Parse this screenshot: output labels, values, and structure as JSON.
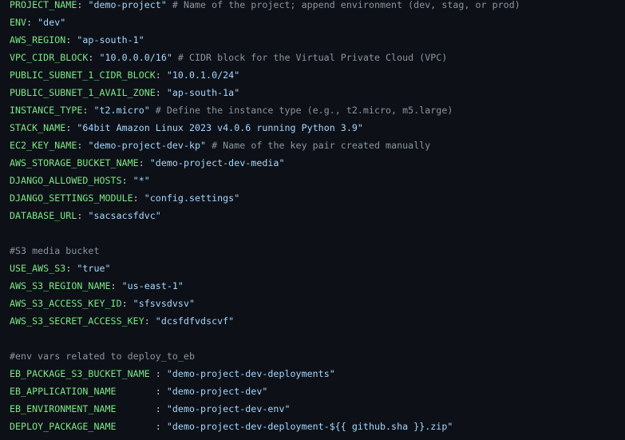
{
  "lines": [
    {
      "key": "PROJECT_NAME",
      "sep": ": ",
      "value": "\"demo-project\"",
      "comment": " # Name of the project; append environment (dev, stag, or prod)"
    },
    {
      "key": "ENV",
      "sep": ": ",
      "value": "\"dev\"",
      "comment": ""
    },
    {
      "key": "AWS_REGION",
      "sep": ": ",
      "value": "\"ap-south-1\"",
      "comment": ""
    },
    {
      "key": "VPC_CIDR_BLOCK",
      "sep": ": ",
      "value": "\"10.0.0.0/16\"",
      "comment": " # CIDR block for the Virtual Private Cloud (VPC)"
    },
    {
      "key": "PUBLIC_SUBNET_1_CIDR_BLOCK",
      "sep": ": ",
      "value": "\"10.0.1.0/24\"",
      "comment": ""
    },
    {
      "key": "PUBLIC_SUBNET_1_AVAIL_ZONE",
      "sep": ": ",
      "value": "\"ap-south-1a\"",
      "comment": ""
    },
    {
      "key": "INSTANCE_TYPE",
      "sep": ": ",
      "value": "\"t2.micro\"",
      "comment": " # Define the instance type (e.g., t2.micro, m5.large)"
    },
    {
      "key": "STACK_NAME",
      "sep": ": ",
      "value": "\"64bit Amazon Linux 2023 v4.0.6 running Python 3.9\"",
      "comment": ""
    },
    {
      "key": "EC2_KEY_NAME",
      "sep": ": ",
      "value": "\"demo-project-dev-kp\"",
      "comment": " # Name of the key pair created manually"
    },
    {
      "key": "AWS_STORAGE_BUCKET_NAME",
      "sep": ": ",
      "value": "\"demo-project-dev-media\"",
      "comment": ""
    },
    {
      "key": "DJANGO_ALLOWED_HOSTS",
      "sep": ": ",
      "value": "\"*\"",
      "comment": ""
    },
    {
      "key": "DJANGO_SETTINGS_MODULE",
      "sep": ": ",
      "value": "\"config.settings\"",
      "comment": ""
    },
    {
      "key": "DATABASE_URL",
      "sep": ": ",
      "value": "\"sacsacsfdvc\"",
      "comment": ""
    },
    {
      "blank": true
    },
    {
      "comment_only": "#S3 media bucket"
    },
    {
      "key": "USE_AWS_S3",
      "sep": ": ",
      "value": "\"true\"",
      "comment": ""
    },
    {
      "key": "AWS_S3_REGION_NAME",
      "sep": ": ",
      "value": "\"us-east-1\"",
      "comment": ""
    },
    {
      "key": "AWS_S3_ACCESS_KEY_ID",
      "sep": ": ",
      "value": "\"sfsvsdvsv\"",
      "comment": ""
    },
    {
      "key": "AWS_S3_SECRET_ACCESS_KEY",
      "sep": ": ",
      "value": "\"dcsfdfvdscvf\"",
      "comment": ""
    },
    {
      "blank": true
    },
    {
      "comment_only": "#env vars related to deploy_to_eb"
    },
    {
      "key": "EB_PACKAGE_S3_BUCKET_NAME",
      "sep": " : ",
      "value": "\"demo-project-dev-deployments\"",
      "comment": ""
    },
    {
      "key": "EB_APPLICATION_NAME",
      "sep": "       : ",
      "value": "\"demo-project-dev\"",
      "comment": ""
    },
    {
      "key": "EB_ENVIRONMENT_NAME",
      "sep": "       : ",
      "value": "\"demo-project-dev-env\"",
      "comment": ""
    },
    {
      "key": "DEPLOY_PACKAGE_NAME",
      "sep": "       : ",
      "value": "\"demo-project-dev-deployment-${{ github.sha }}.zip\"",
      "comment": ""
    }
  ],
  "colors": {
    "background": "#0d1117",
    "key": "#7ee787",
    "string": "#a5d6ff",
    "comment": "#8b949e",
    "text": "#c9d1d9"
  }
}
